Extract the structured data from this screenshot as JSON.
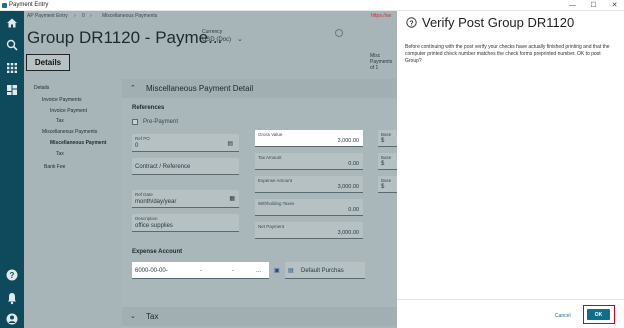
{
  "window": {
    "title": "Payment Entry",
    "minimize": "—",
    "maximize": "☐",
    "close": "✕"
  },
  "nav": {
    "home": "home-icon",
    "search": "search-icon",
    "apps": "apps-grid-icon",
    "dashboard": "dashboard-icon",
    "help": "help-icon",
    "notifications": "bell-icon",
    "user": "user-icon"
  },
  "breadcrumb": {
    "root": "AP Payment Entry",
    "sep1": "›",
    "mid": "0",
    "sep2": "›",
    "current": "Miscellaneous Payments",
    "right_tag": "https://se"
  },
  "page": {
    "title": "Group DR1120 - Payme...",
    "currency_label": "Currency",
    "currency_value": "USD (Doc)",
    "misc_payments_label": "Misc Payments of 1"
  },
  "tabs": {
    "details": "Details"
  },
  "tree": {
    "details": "Details",
    "invoice_payments": "Invoice Payments",
    "invoice_payment": "Invoice Payment",
    "tax1": "Tax",
    "misc_payments": "Miscellaneous Payments",
    "misc_payment": "Miscellaneous Payment",
    "tax2": "Tax",
    "bank_fee": "Bank Fee"
  },
  "section": {
    "title": "Miscellaneous Payment Detail",
    "references": "References",
    "tax_title": "Tax"
  },
  "form": {
    "pre_payment": "Pre-Payment",
    "ref_po_label": "Ref PO",
    "ref_po_value": "0",
    "contract_placeholder": "Contract / Reference",
    "ref_date_label": "Ref Date",
    "ref_date_value": "month/day/year",
    "description_label": "Description",
    "description_value": "office supplies",
    "gross_label": "Gross Value",
    "gross_value": "3,000.00",
    "tax_label": "Tax Amount",
    "tax_value": "0.00",
    "expense_label": "Expense Amount",
    "expense_value": "3,000.00",
    "withholding_label": "Withholding Taxes",
    "withholding_value": "0.00",
    "net_label": "Net Payment",
    "net_value": "3,000.00",
    "base1_label": "Base",
    "base1_value": "$",
    "base2_label": "Base",
    "base2_value": "$",
    "base3_label": "Base",
    "base3_value": "$"
  },
  "expense": {
    "label": "Expense Account",
    "account_value": "6000-00-00-",
    "dash1": "-",
    "dash2": "-",
    "more": "...",
    "default_purchase": "Default Purchas"
  },
  "dialog": {
    "title": "Verify Post Group DR1120",
    "body": "Before continuing with the post verify your checks have actually finished printing and that the computer printed check number matches the check forms preprinted number. OK to post Group?",
    "cancel": "Cancel",
    "ok": "OK"
  },
  "colors": {
    "nav_bg": "#0f4a5c",
    "accent": "#0f6d8e",
    "highlight": "#d0021b"
  }
}
